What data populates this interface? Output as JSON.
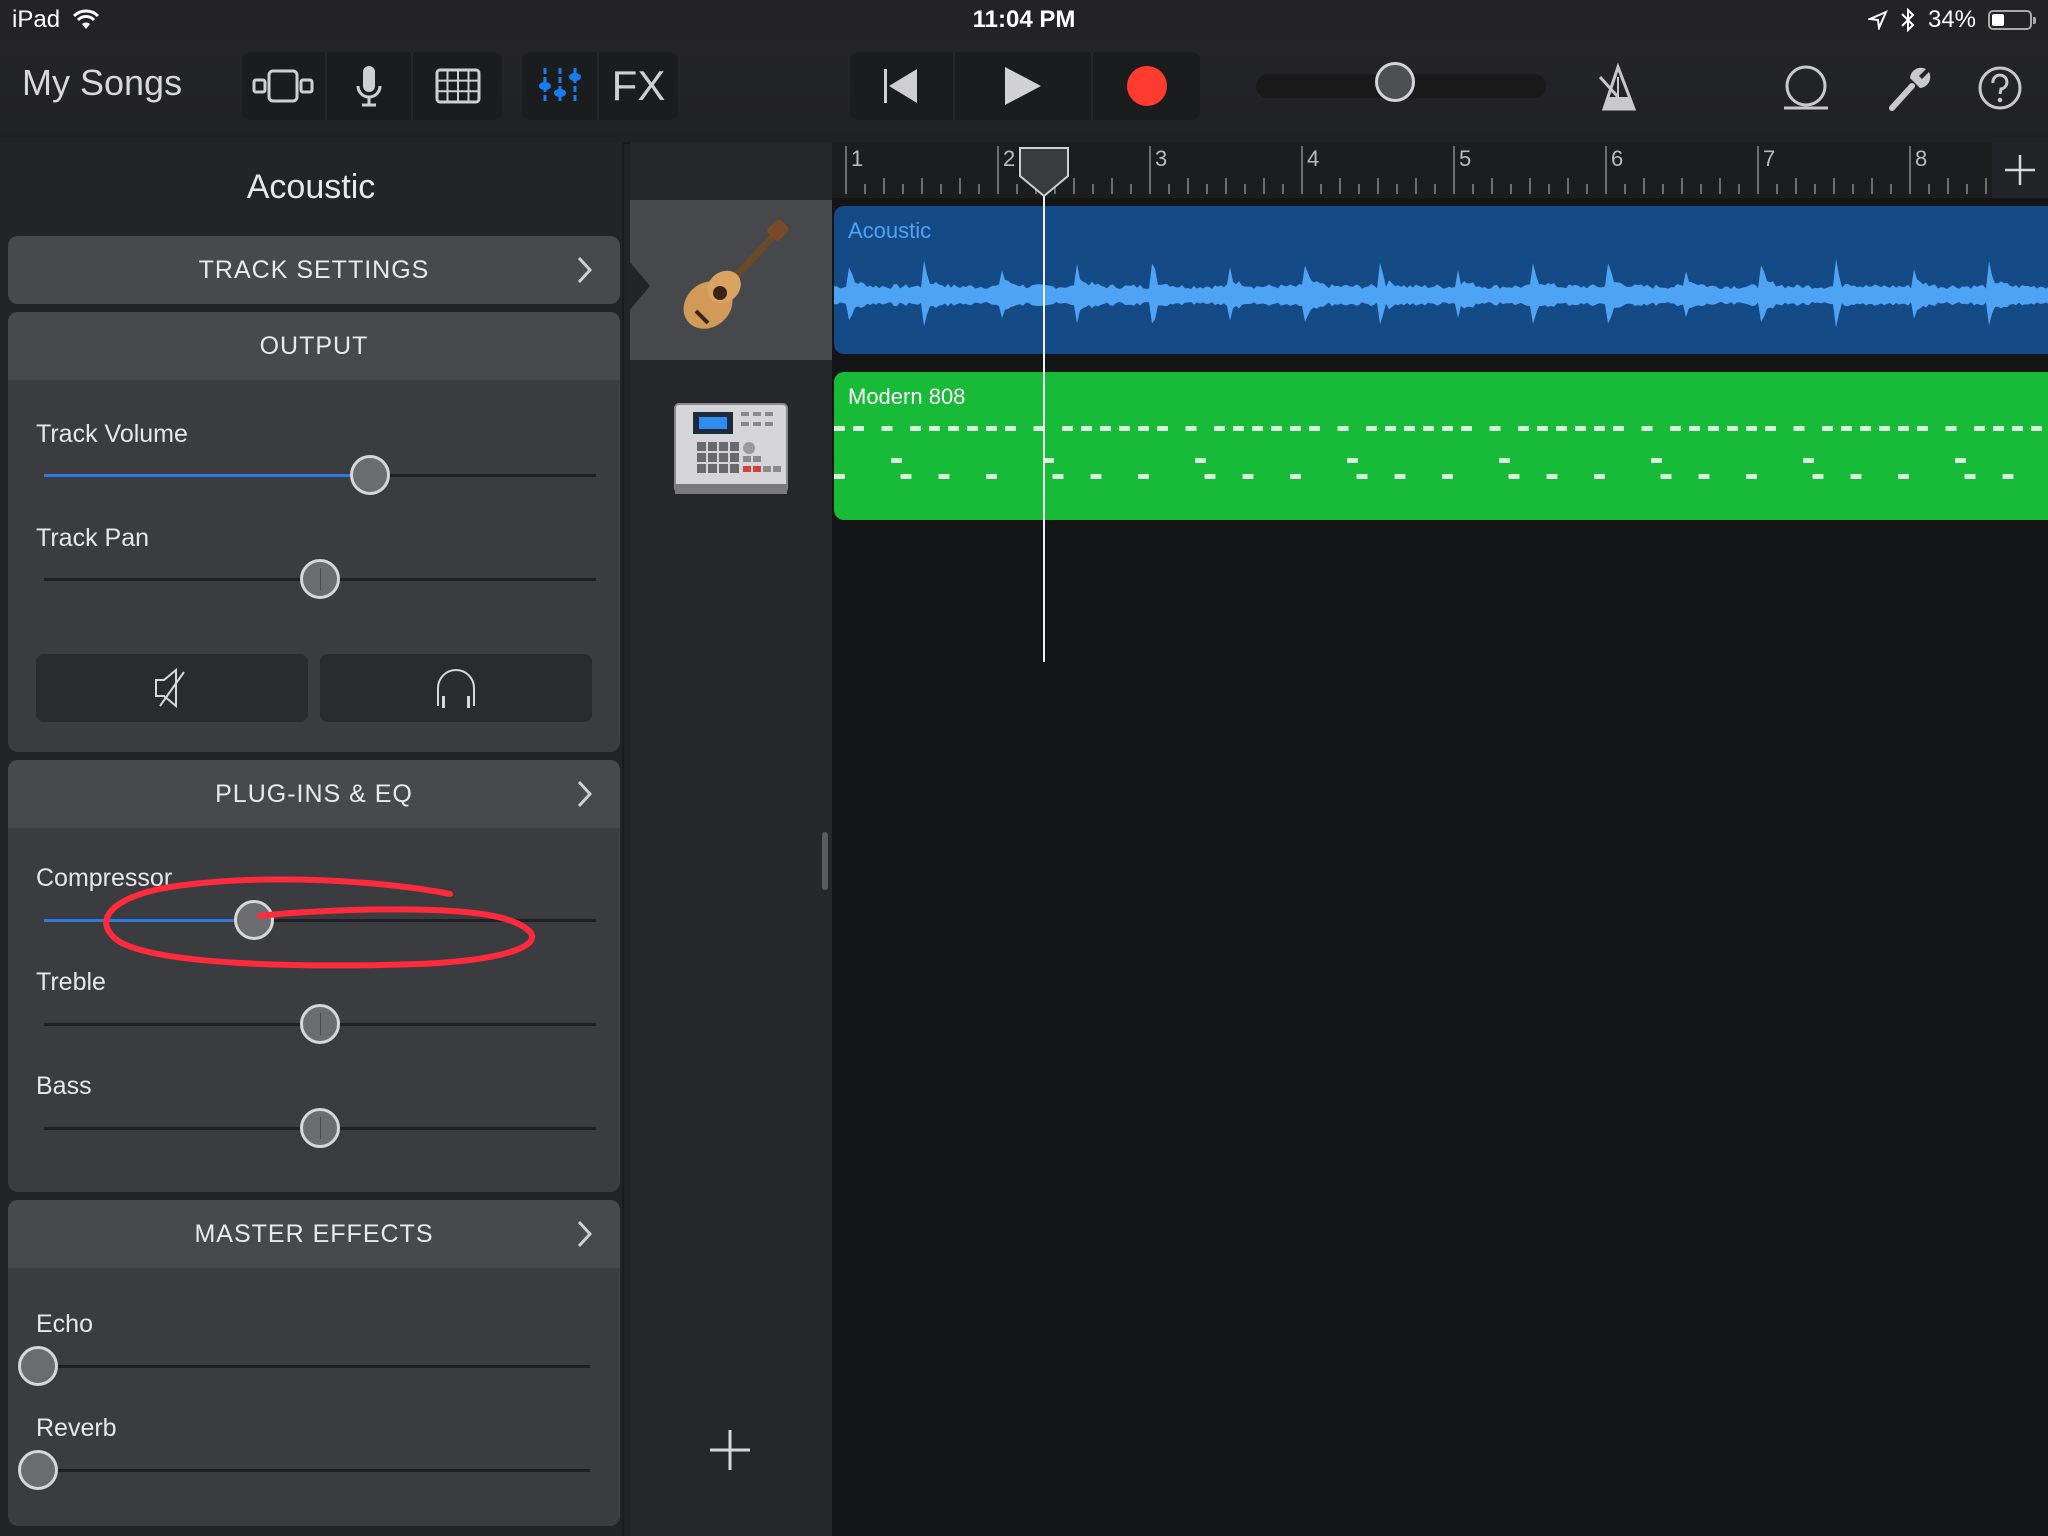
{
  "status_bar": {
    "device": "iPad",
    "time": "11:04 PM",
    "battery_percent": "34%",
    "battery_level": 0.34,
    "icons": [
      "wifi-icon",
      "location-icon",
      "bluetooth-icon",
      "battery-icon"
    ]
  },
  "toolbar": {
    "my_songs_label": "My Songs",
    "view_buttons": [
      {
        "name": "tracks-view",
        "icon": "tracks-view-icon"
      },
      {
        "name": "instrument",
        "icon": "microphone-icon"
      },
      {
        "name": "live-loops",
        "icon": "grid-icon"
      }
    ],
    "mixer_buttons": [
      {
        "name": "track-controls",
        "icon": "sliders-icon",
        "active": true
      },
      {
        "name": "fx",
        "label": "FX"
      }
    ],
    "transport": {
      "rewind_icon": "go-to-beginning-icon",
      "play_icon": "play-icon",
      "record_icon": "record-icon",
      "record_color": "#ff3b30"
    },
    "master_volume": 0.45,
    "right_icons": [
      "metronome-icon",
      "loop-browser-icon",
      "settings-wrench-icon",
      "help-icon"
    ]
  },
  "left_panel": {
    "title": "Acoustic",
    "track_settings": {
      "label": "TRACK SETTINGS"
    },
    "output": {
      "label": "OUTPUT",
      "sliders": [
        {
          "label": "Track Volume",
          "value": 0.59,
          "filled": true
        },
        {
          "label": "Track Pan",
          "value": 0.5,
          "centered": true
        }
      ],
      "mute_icon": "speaker-muted-icon",
      "solo_icon": "headphones-icon"
    },
    "plugins_eq": {
      "label": "PLUG-INS & EQ",
      "sliders": [
        {
          "label": "Compressor",
          "value": 0.38,
          "filled": true
        },
        {
          "label": "Treble",
          "value": 0.5,
          "centered": true
        },
        {
          "label": "Bass",
          "value": 0.5,
          "centered": true
        }
      ]
    },
    "master_effects": {
      "label": "MASTER EFFECTS",
      "sliders": [
        {
          "label": "Echo",
          "value": 0.0
        },
        {
          "label": "Reverb",
          "value": 0.0
        }
      ]
    },
    "annotation_color": "#ff2a3c"
  },
  "tracks": [
    {
      "name": "Acoustic",
      "instrument_icon": "acoustic-guitar-icon",
      "selected": true,
      "region_color": "#144a86",
      "wave_color": "#4ea3f5",
      "label_color": "#4ea3f5"
    },
    {
      "name": "Modern 808",
      "instrument_icon": "drum-machine-icon",
      "selected": false,
      "region_color": "#17bb37",
      "note_color": "#d6f5dc",
      "label_color": "#ffffff"
    }
  ],
  "ruler": {
    "bars": [
      "1",
      "2",
      "3",
      "4",
      "5",
      "6",
      "7",
      "8"
    ],
    "playhead_bar": 2.3
  },
  "add_track_icon": "plus-icon",
  "add_section_icon": "plus-icon"
}
